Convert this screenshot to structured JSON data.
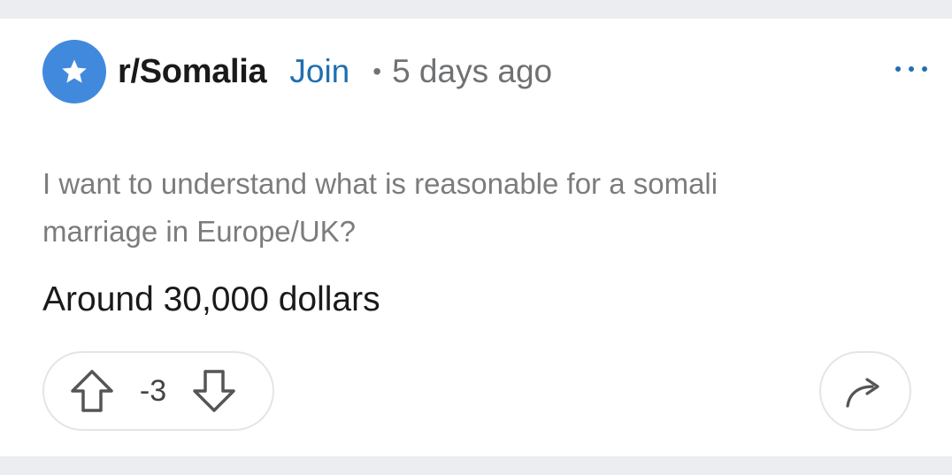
{
  "post": {
    "subreddit": "r/Somalia",
    "join_label": "Join",
    "separator": "•",
    "time_ago": "5 days ago",
    "title": "I want to understand what is reasonable for a somali marriage in Europe/UK?",
    "body": "Around 30,000 dollars",
    "score": "-3"
  },
  "icons": {
    "avatar": "star-icon",
    "more": "more-options-icon",
    "upvote": "upvote-arrow-icon",
    "downvote": "downvote-arrow-icon",
    "share": "share-arrow-icon"
  },
  "colors": {
    "avatar_bg": "#4189dd",
    "join": "#1f6fb2",
    "meta": "#6f7173",
    "title": "#7c7c7c",
    "body": "#1a1a1b"
  }
}
